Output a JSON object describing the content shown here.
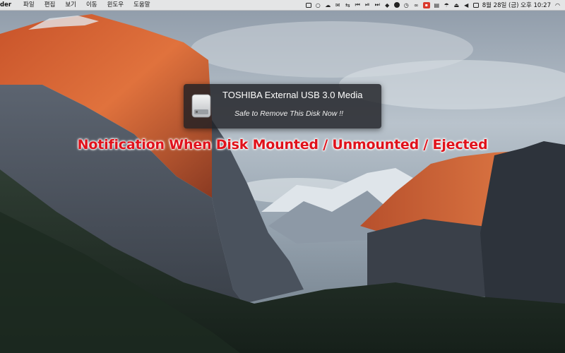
{
  "menubar": {
    "app_name": "der",
    "menus": [
      "파일",
      "편집",
      "보기",
      "이동",
      "윈도우",
      "도움말"
    ],
    "tray_icons": [
      "box-icon",
      "circle-icon",
      "cloud-icon",
      "chat-icon",
      "flip-icon",
      "prev-track-icon",
      "play-pause-icon",
      "next-track-icon",
      "dropbox-icon",
      "lightning-icon",
      "clock-icon",
      "glasses-icon",
      "pdf-icon",
      "clipboard-icon",
      "umbrella-icon",
      "eject-icon",
      "volume-icon",
      "text-input-icon"
    ],
    "datetime": "8월 28일 (금) 오후 10:27",
    "wifi_icon": "wifi-icon"
  },
  "notification": {
    "title": "TOSHIBA External USB 3.0 Media",
    "message": "Safe to Remove This Disk Now !!",
    "icon": "external-disk-icon"
  },
  "caption": "Notification When Disk Mounted / Unmounted / Ejected"
}
